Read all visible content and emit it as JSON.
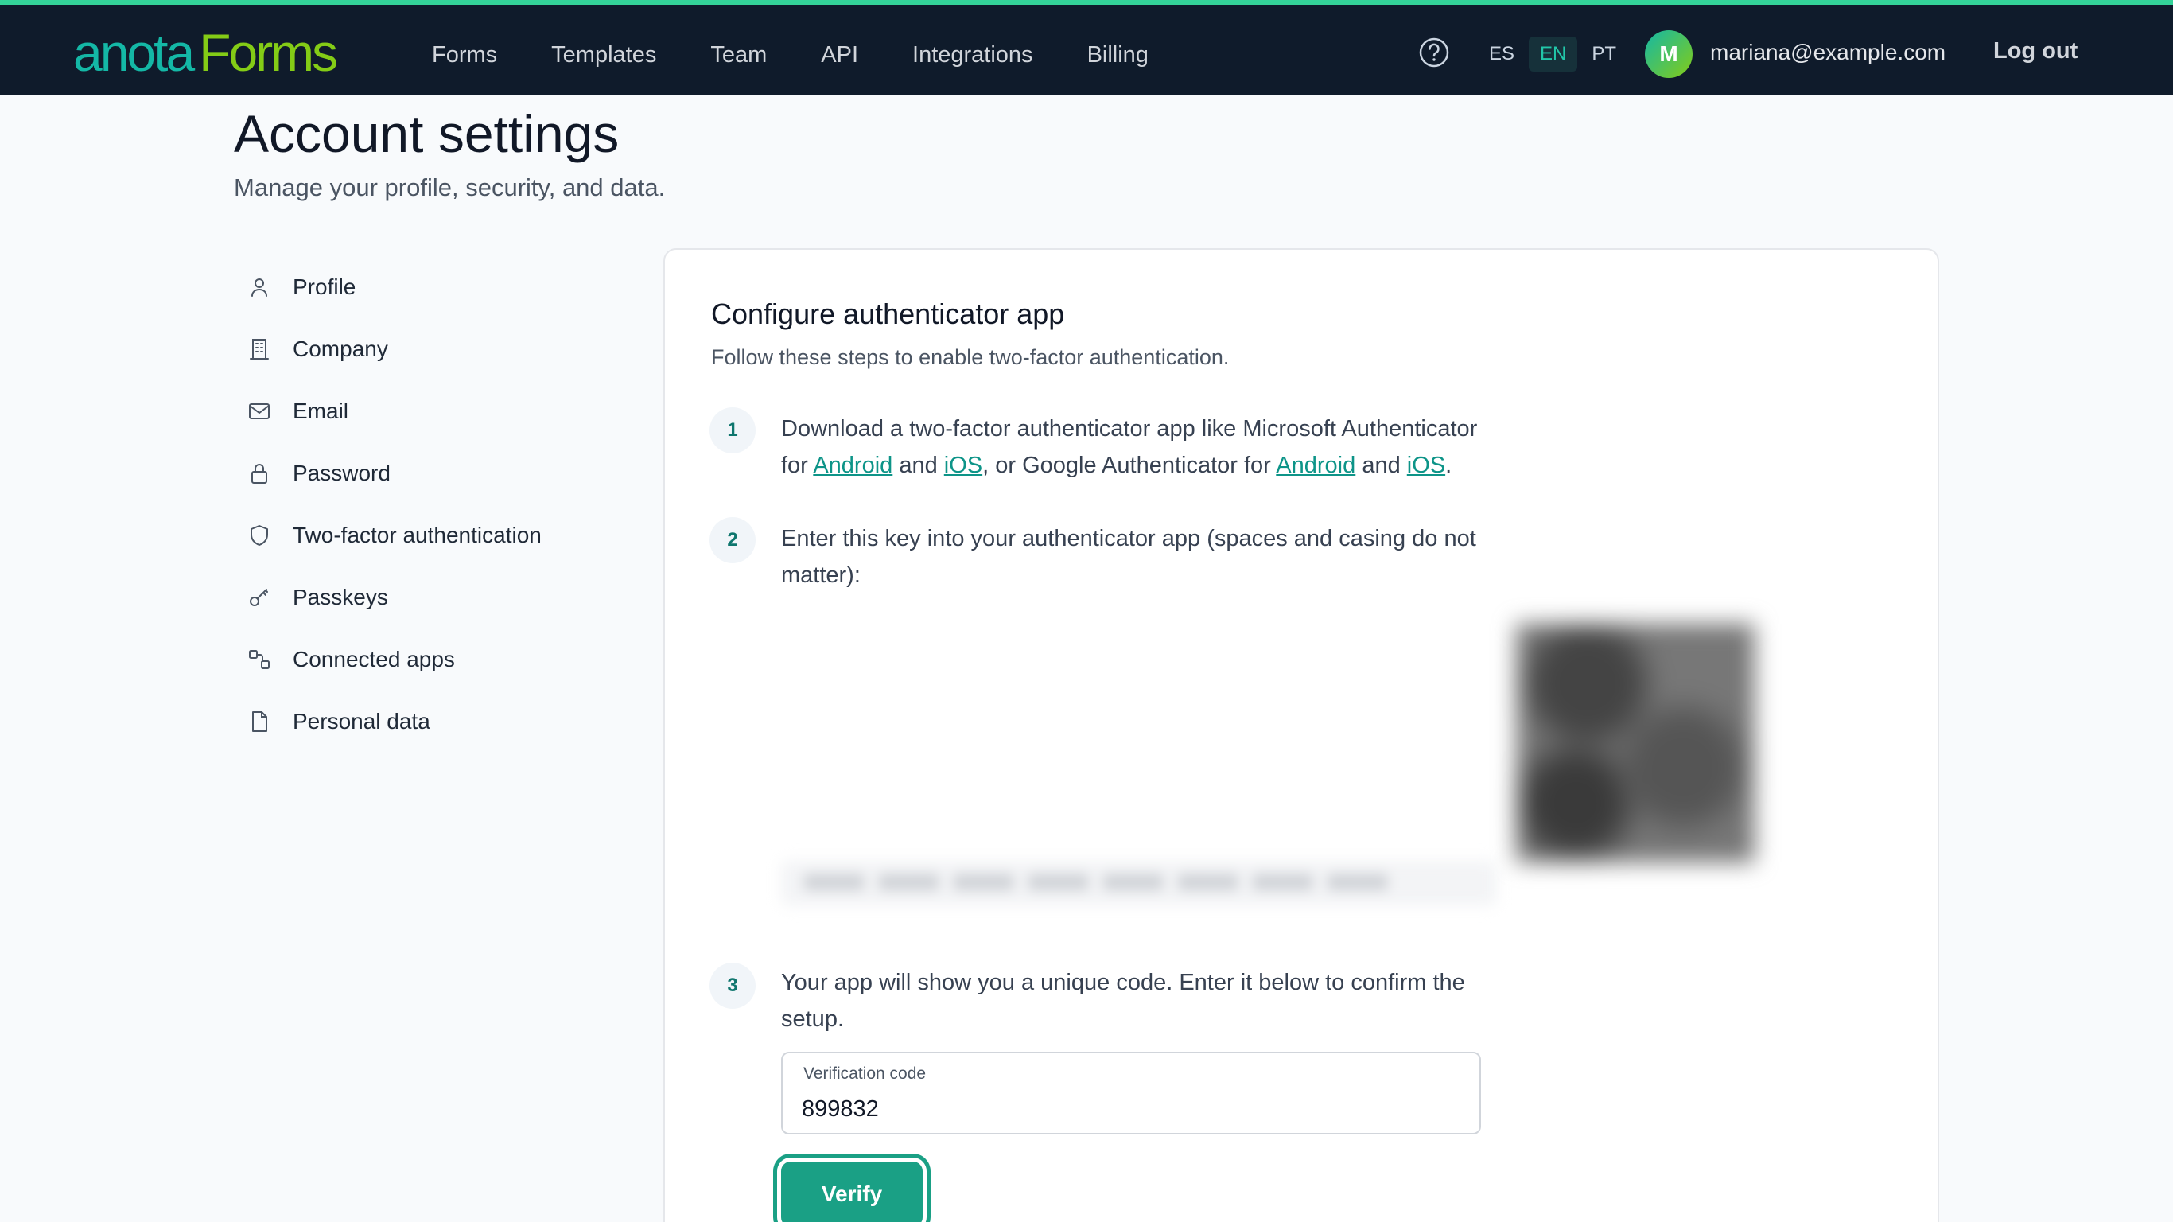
{
  "brand": {
    "part1": "anota",
    "part2": "Forms"
  },
  "nav": [
    "Forms",
    "Templates",
    "Team",
    "API",
    "Integrations",
    "Billing"
  ],
  "header": {
    "help_icon": "question-circle-icon",
    "languages": [
      "ES",
      "EN",
      "PT"
    ],
    "active_language": "EN",
    "avatar_initial": "M",
    "user_email": "mariana@example.com",
    "logout_label": "Log out"
  },
  "page": {
    "title": "Account settings",
    "subtitle": "Manage your profile, security, and data."
  },
  "sidebar": {
    "items": [
      {
        "label": "Profile",
        "icon": "user-icon"
      },
      {
        "label": "Company",
        "icon": "building-icon"
      },
      {
        "label": "Email",
        "icon": "mail-icon"
      },
      {
        "label": "Password",
        "icon": "lock-icon"
      },
      {
        "label": "Two-factor authentication",
        "icon": "shield-icon"
      },
      {
        "label": "Passkeys",
        "icon": "key-icon"
      },
      {
        "label": "Connected apps",
        "icon": "connected-apps-icon"
      },
      {
        "label": "Personal data",
        "icon": "file-icon"
      }
    ]
  },
  "card": {
    "title": "Configure authenticator app",
    "subtitle": "Follow these steps to enable two-factor authentication.",
    "steps": [
      {
        "number": "1",
        "text_before": "Download a two-factor authenticator app like Microsoft Authenticator for ",
        "link_android_ms": "Android",
        "and1": " and ",
        "link_ios_ms": "iOS",
        "middle": ", or Google Authenticator for ",
        "link_android_google": "Android",
        "and2": " and ",
        "link_ios_google": "iOS",
        "end": "."
      },
      {
        "number": "2",
        "text": "Enter this key into your authenticator app (spaces and casing do not matter):"
      },
      {
        "number": "3",
        "text": "Your app will show you a unique code. Enter it below to confirm the setup."
      }
    ],
    "verification": {
      "label": "Verification code",
      "value": "899832"
    },
    "verify_label": "Verify"
  },
  "colors": {
    "header_bg": "#0f1b2b",
    "accent": "#1aa085",
    "link": "#0d9488"
  }
}
